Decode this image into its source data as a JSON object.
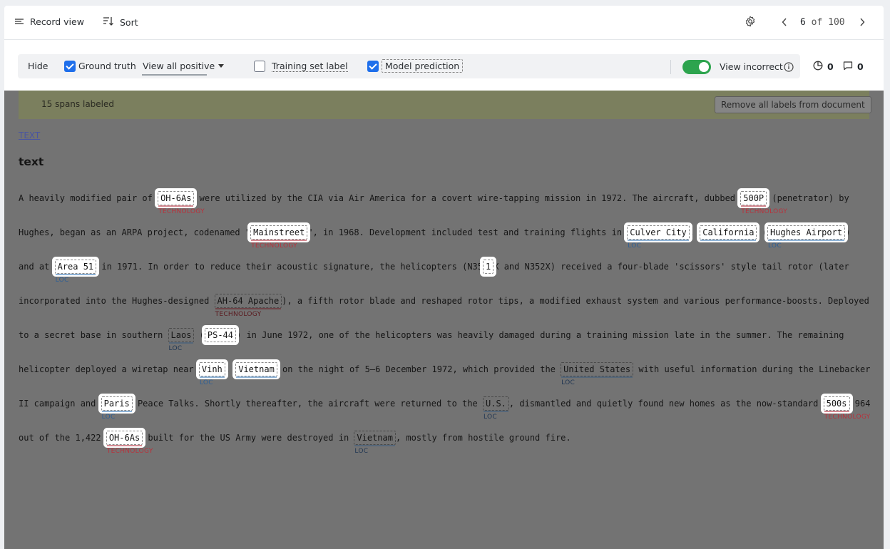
{
  "toolbar": {
    "record_view": "Record view",
    "sort": "Sort",
    "page_current": "6",
    "page_of": "of 100"
  },
  "filters": {
    "hide": "Hide",
    "ground_truth": "Ground truth",
    "view_all_positive": "View all positive",
    "training_set_label": "Training set label",
    "model_prediction": "Model prediction",
    "view_incorrect": "View incorrect",
    "stat_a": "0",
    "stat_b": "0"
  },
  "banner": {
    "spans_labeled": "15 spans labeled",
    "remove_all": "Remove all labels from document"
  },
  "field": {
    "link": "TEXT",
    "heading": "text"
  },
  "document": {
    "l1": [
      "A heavily modified pair of ",
      "OH-6As",
      " were utilized by the CIA via Air America for a covert wire-tapping mission in 1972. The aircraft, dubbed ",
      "500P",
      " (penetrator) by"
    ],
    "l2": [
      "Hughes, began as an ARPA project, codenamed \"",
      "Mainstreet",
      "\", in 1968.  Development included test and training flights in ",
      "Culver City",
      ", ",
      "California",
      " (",
      "Hughes Airport",
      ")"
    ],
    "l3": [
      "and at ",
      "Area 51",
      " in 1971. In order to reduce their acoustic signature, the helicopters (N35",
      "1",
      "X and N352X) received a four-blade 'scissors' style tail rotor (later"
    ],
    "l4": [
      "incorporated into the Hughes-designed ",
      "AH-64 Apache",
      "), a fifth rotor blade and reshaped rotor tips, a modified exhaust system and various performance-boosts.  Deployed"
    ],
    "l5": [
      "to a secret base in southern ",
      "Laos",
      " (",
      "PS-44",
      ") in June 1972, one of the helicopters was heavily damaged during a training mission late in the summer.  The remaining"
    ],
    "l6": [
      "helicopter deployed a wiretap near ",
      "Vinh",
      ", ",
      "Vietnam",
      " on the night of 5–6 December 1972, which provided the ",
      "United States",
      " with useful information during the Linebacker"
    ],
    "l7": [
      "II campaign and ",
      "Paris",
      " Peace Talks. Shortly thereafter, the aircraft were returned to the ",
      "U.S.",
      ", dismantled and quietly found new homes as the now-standard ",
      "500s",
      ".964"
    ],
    "l8": [
      "out of the 1,422 ",
      "OH-6As",
      " built for the US Army were destroyed in ",
      "Vietnam",
      ", mostly from hostile ground fire."
    ]
  },
  "labels": {
    "tech": "TECHNOLOGY",
    "loc": "LOC"
  }
}
